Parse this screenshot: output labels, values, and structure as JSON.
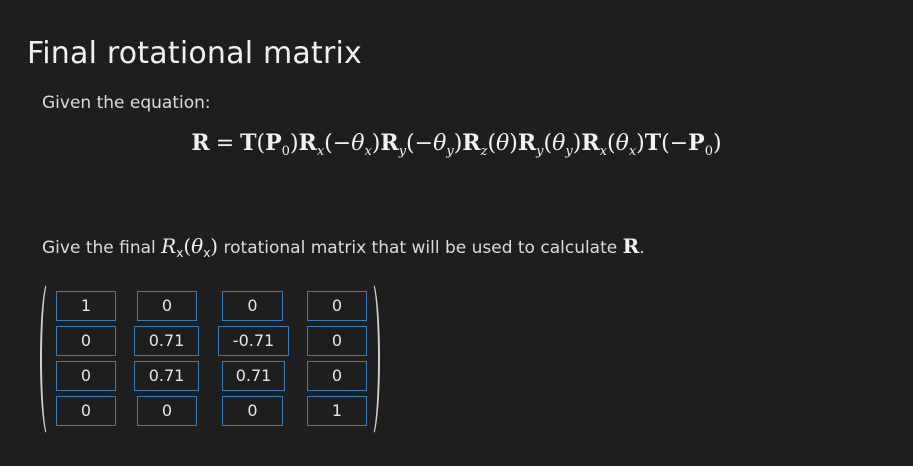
{
  "page": {
    "title": "Final rotational matrix",
    "given_label": "Given the equation:",
    "question_prefix": "Give the final ",
    "question_suffix": " rotational matrix that will be used to calculate ",
    "question_end": "."
  },
  "matrix": {
    "rows": [
      [
        "1",
        "0",
        "0",
        "0"
      ],
      [
        "0",
        "0.71",
        "-0.71",
        "0"
      ],
      [
        "0",
        "0.71",
        "0.71",
        "0"
      ],
      [
        "0",
        "0",
        "0",
        "1"
      ]
    ]
  }
}
